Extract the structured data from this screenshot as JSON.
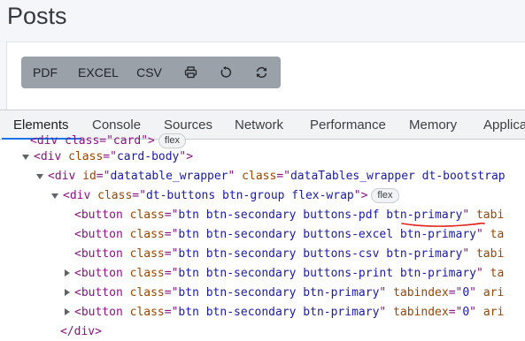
{
  "page": {
    "title": "Posts"
  },
  "toolbar": {
    "pdf_label": "PDF",
    "excel_label": "EXCEL",
    "csv_label": "CSV",
    "print_icon": "printer-icon",
    "undo_icon": "rotate-ccw-icon",
    "refresh_icon": "refresh-icon"
  },
  "devtools": {
    "tabs": [
      "Elements",
      "Console",
      "Sources",
      "Network",
      "Performance",
      "Memory",
      "Applica"
    ],
    "active_tab": "Elements",
    "badge_flex": "flex",
    "partial_line": {
      "open": "<div class=\"card\">",
      "badge": "flex"
    },
    "lines": [
      {
        "open": "<div ",
        "an1": "class",
        "eq1": "=\"",
        "av1": "card-body",
        "close1": "\">"
      },
      {
        "open": "<div ",
        "an1": "id",
        "eq1": "=\"",
        "av1": "datatable_wrapper",
        "mid1": "\" ",
        "an2": "class",
        "eq2": "=\"",
        "av2": "dataTables_wrapper dt-bootstrap"
      },
      {
        "open": "<div ",
        "an1": "class",
        "eq1": "=\"",
        "av1": "dt-buttons btn-group flex-wrap",
        "close1": "\">"
      },
      {
        "open": "<button ",
        "an1": "class",
        "eq1": "=\"",
        "av1": "btn btn-secondary buttons-pdf btn-primary",
        "mid1": "\" ",
        "an2": "tabi"
      },
      {
        "open": "<button ",
        "an1": "class",
        "eq1": "=\"",
        "av1": "btn btn-secondary buttons-excel btn-primary",
        "mid1": "\" ",
        "an2": "ta"
      },
      {
        "open": "<button ",
        "an1": "class",
        "eq1": "=\"",
        "av1": "btn btn-secondary buttons-csv btn-primary",
        "mid1": "\" ",
        "an2": "tabi"
      },
      {
        "open": "<button ",
        "an1": "class",
        "eq1": "=\"",
        "av1": "btn btn-secondary buttons-print btn-primary",
        "mid1": "\" ",
        "an2": "ta"
      },
      {
        "open": "<button ",
        "an1": "class",
        "eq1": "=\"",
        "av1": "btn btn-secondary btn-primary",
        "mid1": "\" ",
        "an2": "tabindex",
        "eq2": "=\"",
        "av2": "0",
        "mid2": "\" ",
        "an3": "ari"
      },
      {
        "open": "<button ",
        "an1": "class",
        "eq1": "=\"",
        "av1": "btn btn-secondary btn-primary",
        "mid1": "\" ",
        "an2": "tabindex",
        "eq2": "=\"",
        "av2": "0",
        "mid2": "\" ",
        "an3": "ari"
      },
      {
        "open": "</div>"
      }
    ]
  },
  "colors": {
    "tag": "#881280",
    "attr_name": "#994500",
    "attr_value": "#1a1aa6",
    "active_tab_underline": "#1a73e8",
    "annotation": "#e0201b"
  }
}
